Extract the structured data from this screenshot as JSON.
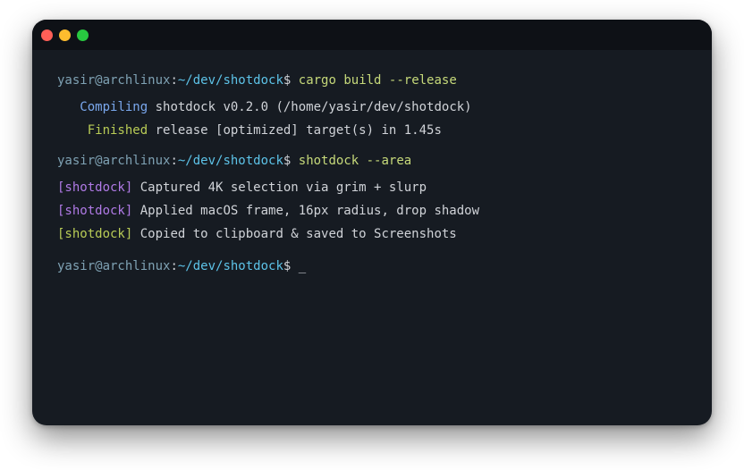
{
  "window": {
    "buttons": [
      {
        "name": "close",
        "color": "#ff5f57"
      },
      {
        "name": "minimize",
        "color": "#febc2e"
      },
      {
        "name": "maximize",
        "color": "#28c840"
      }
    ],
    "background": "#161b22"
  },
  "terminal": {
    "prompt": {
      "user_host": "yasir@archlinux",
      "colon": ":",
      "path": "~/dev/shotdock",
      "dollar": "$"
    },
    "lines": {
      "cmd1": "cargo build --release",
      "compile_label": "Compiling",
      "compile_text": "shotdock v0.2.0 (/home/yasir/dev/shotdock)",
      "finished_label": "Finished",
      "finished_text": "release [optimized] target(s) in 1.45s",
      "cmd2": "shotdock --area",
      "tag": "[shotdock]",
      "log1": "Captured 4K selection via grim + slurp",
      "log2": "Applied macOS frame, 16px radius, drop shadow",
      "log3": "Copied to clipboard & saved to Screenshots",
      "cursor": "_"
    }
  }
}
